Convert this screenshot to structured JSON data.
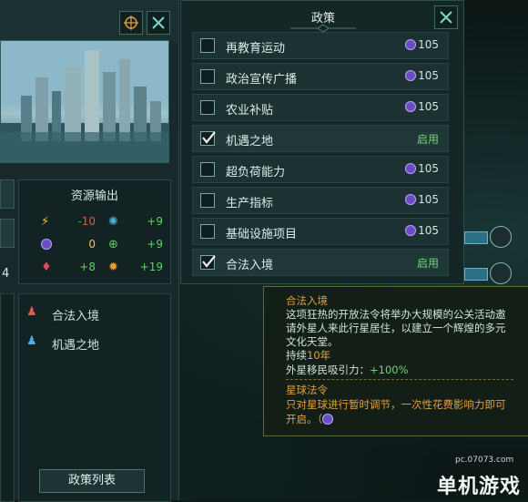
{
  "edicts_panel": {
    "title": "政策",
    "items": [
      {
        "label": "再教育运动",
        "cost": "105",
        "checked": false,
        "status": ""
      },
      {
        "label": "政治宣传广播",
        "cost": "105",
        "checked": false,
        "status": ""
      },
      {
        "label": "农业补贴",
        "cost": "105",
        "checked": false,
        "status": ""
      },
      {
        "label": "机遇之地",
        "cost": "",
        "checked": true,
        "status": "启用"
      },
      {
        "label": "超负荷能力",
        "cost": "105",
        "checked": false,
        "status": ""
      },
      {
        "label": "生产指标",
        "cost": "105",
        "checked": false,
        "status": ""
      },
      {
        "label": "基础设施项目",
        "cost": "105",
        "checked": false,
        "status": ""
      },
      {
        "label": "合法入境",
        "cost": "",
        "checked": true,
        "status": "启用"
      }
    ]
  },
  "resources": {
    "title": "资源输出",
    "values": [
      {
        "icon": "energy-icon",
        "value": "-10",
        "color": "#e05a4a"
      },
      {
        "icon": "research-icon",
        "value": "+9",
        "color": "#5fd06a"
      },
      {
        "icon": "influence-icon",
        "value": "0",
        "color": "#f0c64a"
      },
      {
        "icon": "food-icon",
        "value": "+9",
        "color": "#5fd06a"
      },
      {
        "icon": "crystal-icon",
        "value": "+8",
        "color": "#5fd06a"
      },
      {
        "icon": "minerals-icon",
        "value": "+19",
        "color": "#5fd06a"
      }
    ]
  },
  "side_number": "4",
  "active_edicts": [
    {
      "label": "合法入境"
    },
    {
      "label": "机遇之地"
    }
  ],
  "edict_list_button": "政策列表",
  "tooltip": {
    "name": "合法入境",
    "desc_line1": "这项狂热的开放法令将举办大规模的公关活动邀",
    "desc_line2": "请外星人来此行星居住，以建立一个辉煌的多元",
    "desc_line3": "文化天堂。",
    "duration_label": "持续",
    "duration_value": "10年",
    "modifier_label": "外星移民吸引力：",
    "modifier_value": "+100%",
    "type_label": "星球法令",
    "type_desc_line1": "只对星球进行暂时调节，一次性花费影响力即可",
    "type_desc_line2": "开启。（"
  },
  "watermark": {
    "site": "pc.07073.com",
    "brand": "单机游戏"
  },
  "colors": {
    "accent": "#6fd37a",
    "influence": "#6c4cc5",
    "tooltip_title": "#e0a040"
  }
}
